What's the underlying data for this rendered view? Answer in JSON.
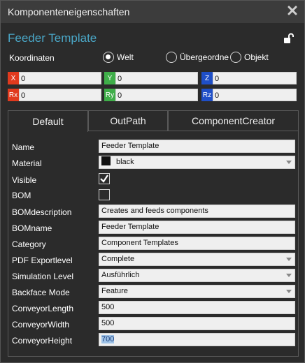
{
  "window": {
    "title": "Komponenteneigenschaften",
    "close_icon": "close-icon"
  },
  "component": {
    "name": "Feeder Template",
    "lock_icon": "unlock-icon"
  },
  "coordinates": {
    "label": "Koordinaten",
    "options": [
      {
        "label": "Welt",
        "selected": true
      },
      {
        "label": "Übergeordnet",
        "selected": false
      },
      {
        "label": "Objekt",
        "selected": false
      }
    ],
    "fields": [
      {
        "tag": "X",
        "value": "0",
        "color": "#e03a1e"
      },
      {
        "tag": "Y",
        "value": "0",
        "color": "#3fae49"
      },
      {
        "tag": "Z",
        "value": "0",
        "color": "#1f4fc7"
      },
      {
        "tag": "Rx",
        "value": "0",
        "color": "#e03a1e"
      },
      {
        "tag": "Ry",
        "value": "0",
        "color": "#3fae49"
      },
      {
        "tag": "Rz",
        "value": "0",
        "color": "#1f4fc7"
      }
    ]
  },
  "tabs": [
    {
      "label": "Default",
      "active": true
    },
    {
      "label": "OutPath",
      "active": false
    },
    {
      "label": "ComponentCreator",
      "active": false
    }
  ],
  "properties": {
    "name": {
      "label": "Name",
      "value": "Feeder Template"
    },
    "material": {
      "label": "Material",
      "value": "black"
    },
    "visible": {
      "label": "Visible",
      "checked": true
    },
    "bom": {
      "label": "BOM",
      "checked": false
    },
    "bomdescription": {
      "label": "BOMdescription",
      "value": "Creates and feeds components"
    },
    "bomname": {
      "label": "BOMname",
      "value": "Feeder Template"
    },
    "category": {
      "label": "Category",
      "value": "Component Templates"
    },
    "pdf_exportlevel": {
      "label": "PDF Exportlevel",
      "value": "Complete"
    },
    "simulation_level": {
      "label": "Simulation Level",
      "value": "Ausführlich"
    },
    "backface_mode": {
      "label": "Backface Mode",
      "value": "Feature"
    },
    "conveyor_length": {
      "label": "ConveyorLength",
      "value": "500"
    },
    "conveyor_width": {
      "label": "ConveyorWidth",
      "value": "500"
    },
    "conveyor_height": {
      "label": "ConveyorHeight",
      "value": "700"
    }
  }
}
